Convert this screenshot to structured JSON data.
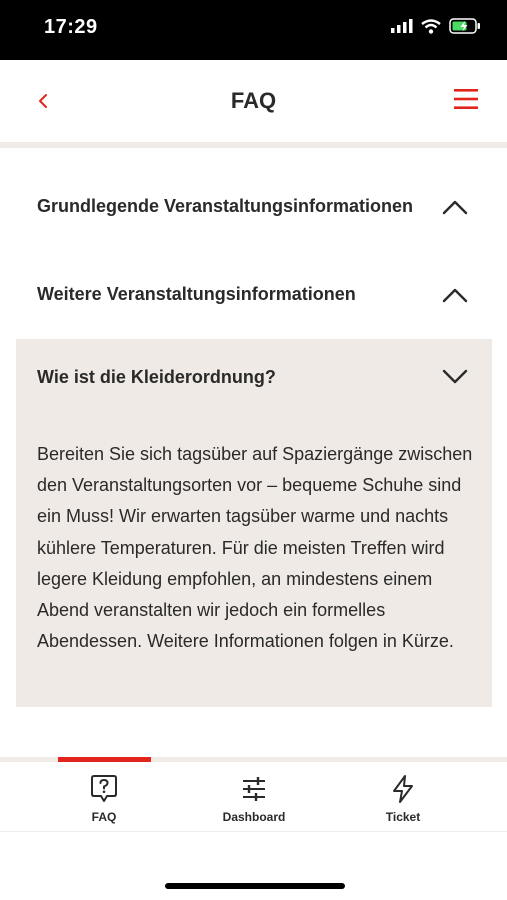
{
  "status_bar": {
    "time": "17:29"
  },
  "header": {
    "title": "FAQ"
  },
  "faq": {
    "items": [
      {
        "question": "Grundlegende Veranstaltungsinformationen"
      },
      {
        "question": "Weitere Veranstaltungsinformationen"
      },
      {
        "question": "Wie ist die Kleiderordnung?",
        "answer": "Bereiten Sie sich tagsüber auf Spaziergänge zwischen den Veranstaltungsorten vor – bequeme Schuhe sind ein Muss! Wir erwarten tagsüber warme und nachts kühlere Temperaturen. Für die meisten Treffen wird legere Kleidung empfohlen, an mindestens einem Abend veranstalten wir jedoch ein formelles Abendessen. Weitere Informationen folgen in Kürze."
      }
    ]
  },
  "tabs": [
    {
      "label": "FAQ",
      "icon": "question-bubble-icon"
    },
    {
      "label": "Dashboard",
      "icon": "sliders-icon"
    },
    {
      "label": "Ticket",
      "icon": "lightning-icon"
    }
  ],
  "colors": {
    "accent": "#e1251b",
    "expanded_bg": "#efeae5",
    "divider": "#f0ebe7",
    "text": "#2a2a2a"
  }
}
